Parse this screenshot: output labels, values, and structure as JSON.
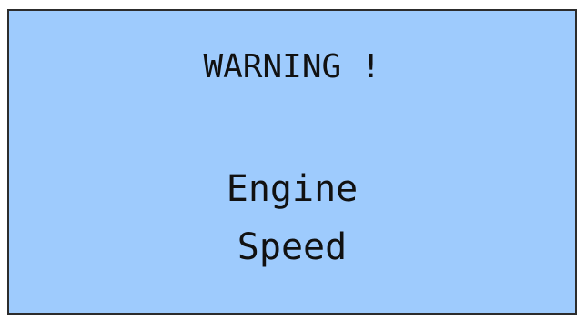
{
  "warning_panel": {
    "title": "WARNING !",
    "message_lines": [
      "Engine",
      "Speed"
    ]
  },
  "colors": {
    "panel_background": "#9ecbfd",
    "border": "#2c2c2c",
    "text": "#111111"
  }
}
